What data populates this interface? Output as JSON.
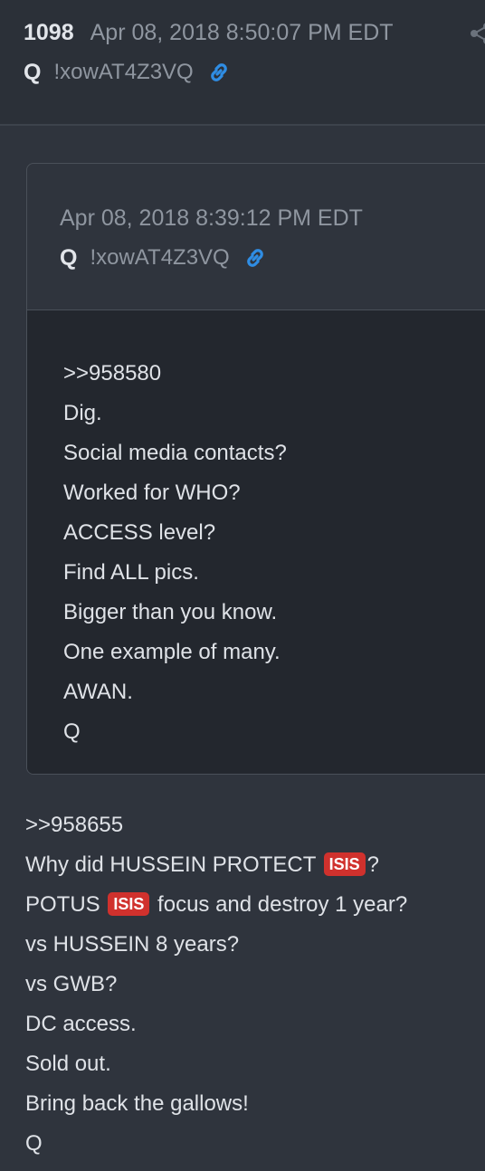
{
  "post": {
    "number": "1098",
    "timestamp": "Apr 08, 2018 8:50:07 PM EDT",
    "author": "Q",
    "tripcode": "!xowAT4Z3VQ"
  },
  "quoted_post": {
    "timestamp": "Apr 08, 2018 8:39:12 PM EDT",
    "author": "Q",
    "tripcode": "!xowAT4Z3VQ",
    "lines": [
      ">>958580",
      "Dig.",
      "Social media contacts?",
      "Worked for WHO?",
      "ACCESS level?",
      "Find ALL pics.",
      "Bigger than you know.",
      "One example of many.",
      "AWAN.",
      "Q"
    ]
  },
  "body": {
    "line1": ">>958655",
    "line2_pre": "Why did HUSSEIN PROTECT",
    "line2_tag": "ISIS",
    "line2_post": "?",
    "line3_pre": "POTUS",
    "line3_tag": "ISIS",
    "line3_post": "focus and destroy 1 year?",
    "line4": "vs HUSSEIN 8 years?",
    "line5": "vs GWB?",
    "line6": "DC access.",
    "line7": "Sold out.",
    "line8": "Bring back the gallows!",
    "line9": "Q"
  },
  "colors": {
    "background": "#2f343d",
    "quote_body": "#23272e",
    "link_icon": "#2f8de4",
    "tag": "#d0312d"
  },
  "icons": [
    "share-icon",
    "link-icon"
  ]
}
